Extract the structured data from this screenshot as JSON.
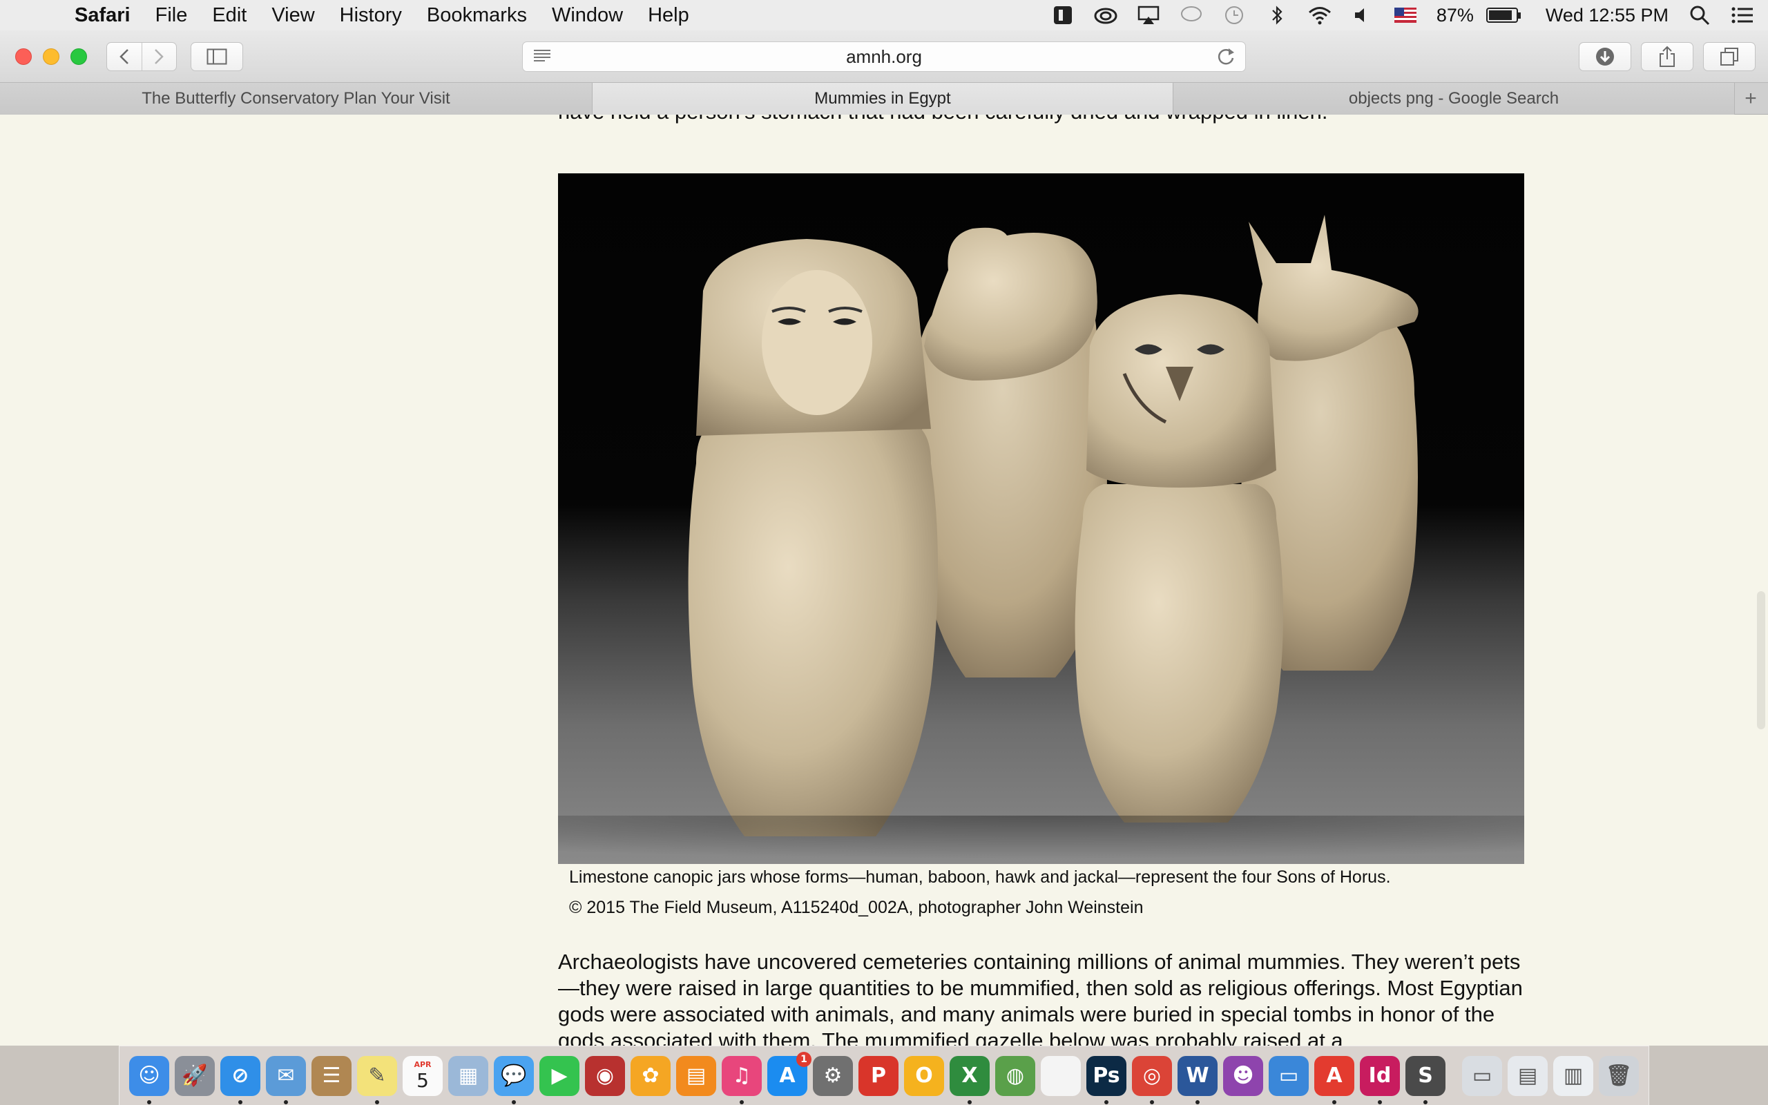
{
  "menubar": {
    "app": "Safari",
    "items": [
      "File",
      "Edit",
      "View",
      "History",
      "Bookmarks",
      "Window",
      "Help"
    ],
    "battery_percent": "87%",
    "battery_level": 0.87,
    "clock": "Wed 12:55 PM"
  },
  "toolbar": {
    "url": "amnh.org"
  },
  "tabs": [
    {
      "label": "The Butterfly Conservatory Plan Your Visit",
      "active": false
    },
    {
      "label": "Mummies in Egypt",
      "active": true
    },
    {
      "label": "objects png - Google Search",
      "active": false
    }
  ],
  "article": {
    "top_text": "have held a person’s stomach that had been carefully dried and wrapped in linen.",
    "caption_line1": "Limestone canopic jars whose forms—human, baboon, hawk and jackal—represent the four Sons of Horus.",
    "caption_line2": "© 2015 The Field Museum, A115240d_002A, photographer John Weinstein",
    "body_text": "Archaeologists have uncovered cemeteries containing millions of animal mummies. They weren’t pets—they were raised in large quantities to be mummified, then sold as religious offerings. Most Egyptian gods were associated with animals, and many animals were buried in special tombs in honor of the gods associated with them.  The mummified gazelle below was probably raised at a"
  },
  "dock": {
    "calendar_month": "APR",
    "calendar_day": "5",
    "appstore_badge": "1",
    "apps": [
      {
        "name": "finder-icon",
        "glyph": "☺",
        "color": "#3d8de8",
        "running": true
      },
      {
        "name": "launchpad-icon",
        "glyph": "🚀",
        "color": "#8a8f98",
        "running": false
      },
      {
        "name": "safari-icon",
        "glyph": "⊘",
        "color": "#2f8fe8",
        "running": true
      },
      {
        "name": "mail-icon",
        "glyph": "✉",
        "color": "#5b9bd8",
        "running": true
      },
      {
        "name": "contacts-icon",
        "glyph": "☰",
        "color": "#b08752",
        "running": false
      },
      {
        "name": "notes-icon",
        "glyph": "✎",
        "color": "#f3e27a",
        "running": true
      },
      {
        "name": "calendar-icon",
        "glyph": "",
        "color": "#fafafa",
        "running": false
      },
      {
        "name": "preview-icon",
        "glyph": "▦",
        "color": "#9bb8d8",
        "running": false
      },
      {
        "name": "messages-icon",
        "glyph": "💬",
        "color": "#4aa3f0",
        "running": true
      },
      {
        "name": "facetime-icon",
        "glyph": "▶",
        "color": "#34c34f",
        "running": false
      },
      {
        "name": "photo-booth-icon",
        "glyph": "◉",
        "color": "#b8312f",
        "running": false
      },
      {
        "name": "photos-icon",
        "glyph": "✿",
        "color": "#f5a623",
        "running": false
      },
      {
        "name": "ibooks-icon",
        "glyph": "▤",
        "color": "#f28a1d",
        "running": false
      },
      {
        "name": "itunes-icon",
        "glyph": "♫",
        "color": "#e8467c",
        "running": true
      },
      {
        "name": "app-store-icon",
        "glyph": "A",
        "color": "#1b8cf0",
        "running": false
      },
      {
        "name": "system-preferences-icon",
        "glyph": "⚙",
        "color": "#707070",
        "running": false
      },
      {
        "name": "p-app-icon",
        "glyph": "P",
        "color": "#d9352a",
        "running": false
      },
      {
        "name": "orange-o-app-icon",
        "glyph": "O",
        "color": "#f5b21e",
        "running": false
      },
      {
        "name": "excel-icon",
        "glyph": "X",
        "color": "#2f8c3e",
        "running": true
      },
      {
        "name": "globe-app-icon",
        "glyph": "◍",
        "color": "#5aa04a",
        "running": false
      },
      {
        "name": "blank-document-icon",
        "glyph": "",
        "color": "#f4f4f4",
        "running": false
      },
      {
        "name": "photoshop-icon",
        "glyph": "Ps",
        "color": "#0c2a45",
        "running": true
      },
      {
        "name": "chrome-icon",
        "glyph": "◎",
        "color": "#db4437",
        "running": true
      },
      {
        "name": "word-icon",
        "glyph": "W",
        "color": "#2b579a",
        "running": true
      },
      {
        "name": "github-icon",
        "glyph": "☻",
        "color": "#8e44ad",
        "running": false
      },
      {
        "name": "keynote-icon",
        "glyph": "▭",
        "color": "#3a87d9",
        "running": false
      },
      {
        "name": "acrobat-icon",
        "glyph": "A",
        "color": "#e33b2f",
        "running": true
      },
      {
        "name": "indesign-icon",
        "glyph": "Id",
        "color": "#c81c5f",
        "running": true
      },
      {
        "name": "sublime-icon",
        "glyph": "S",
        "color": "#4a4a4a",
        "running": true
      }
    ],
    "stacks": [
      {
        "name": "screenshot-stack-icon",
        "glyph": "▭",
        "color": "#d9dde2"
      },
      {
        "name": "documents-stack-icon",
        "glyph": "▤",
        "color": "#e6e9ed"
      },
      {
        "name": "downloads-stack-icon",
        "glyph": "▥",
        "color": "#eceff2"
      },
      {
        "name": "trash-icon",
        "glyph": "🗑",
        "color": "#cfd3d8"
      }
    ]
  }
}
